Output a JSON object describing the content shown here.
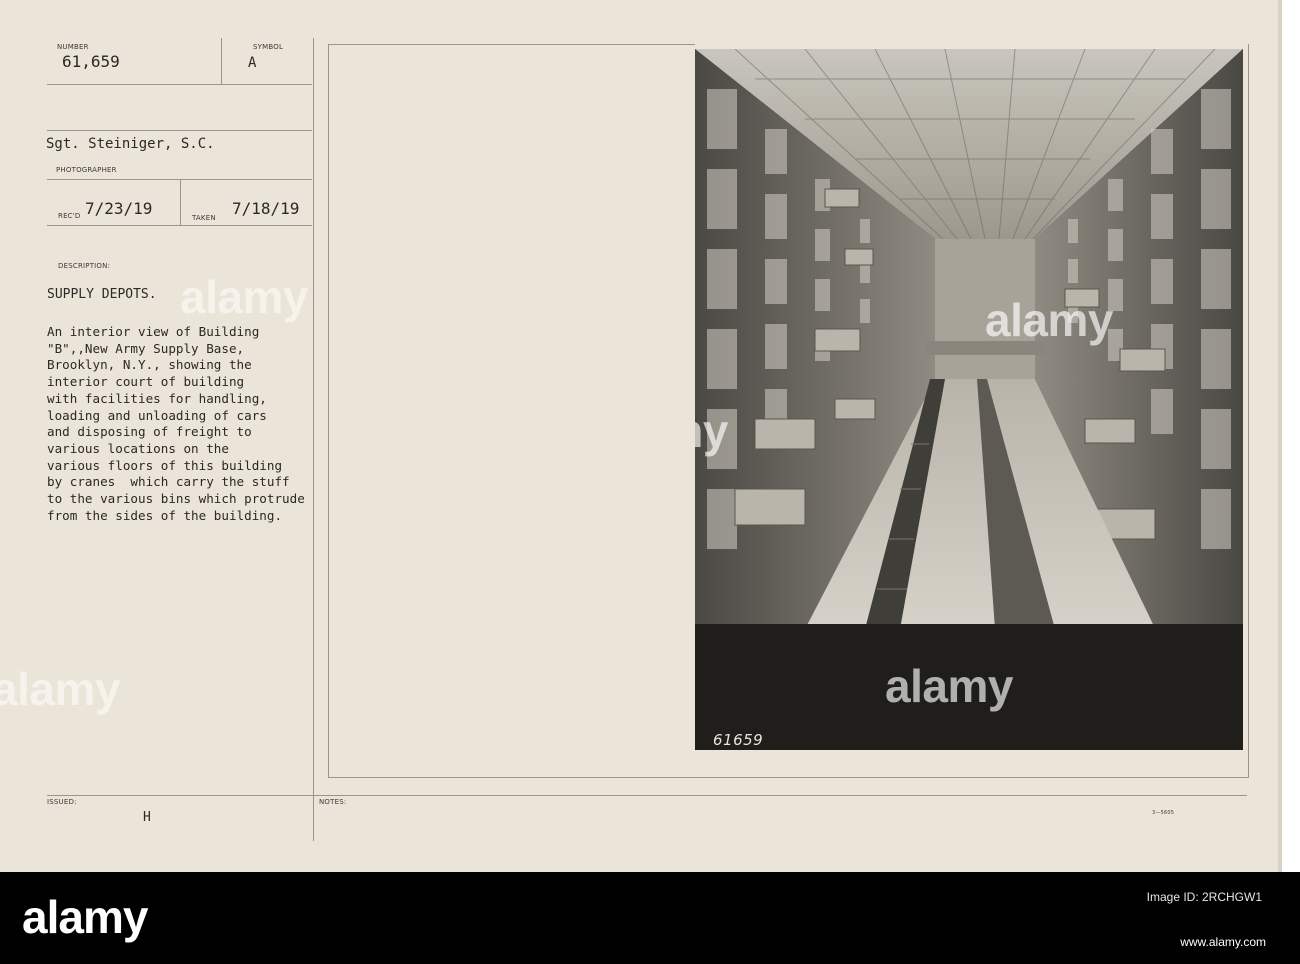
{
  "card": {
    "number_label": "NUMBER",
    "number_value": "61,659",
    "symbol_label": "SYMBOL",
    "symbol_value": "A",
    "photographer_value": "Sgt. Steiniger, S.C.",
    "photographer_label": "PHOTOGRAPHER",
    "recd_label": "REC'D",
    "recd_value": "7/23/19",
    "taken_label": "TAKEN",
    "taken_value": "7/18/19",
    "description_label": "DESCRIPTION:",
    "category": "SUPPLY DEPOTS.",
    "description": "An interior view of Building\n\"B\",,New Army Supply Base,\nBrooklyn, N.Y., showing the\ninterior court of building\nwith facilities for handling,\nloading and unloading of cars\nand disposing of freight to\nvarious locations on the\nvarious floors of this building\nby cranes  which carry the stuff\nto the various bins which protrude\nfrom the sides of the building.",
    "issued_label": "ISSUED:",
    "issued_value": "H",
    "notes_label": "NOTES:",
    "form_code": "3—5605"
  },
  "photo": {
    "negative_number": "61659"
  },
  "watermarks": {
    "text": "alamy"
  },
  "footer": {
    "logo": "alamy",
    "image_id_label": "Image ID: 2RCHGW1",
    "code": "2RCHGW1",
    "url": "www.alamy.com"
  },
  "colors": {
    "card": "#ebe4d8",
    "ink": "#2b2925",
    "footer": "#000000"
  }
}
